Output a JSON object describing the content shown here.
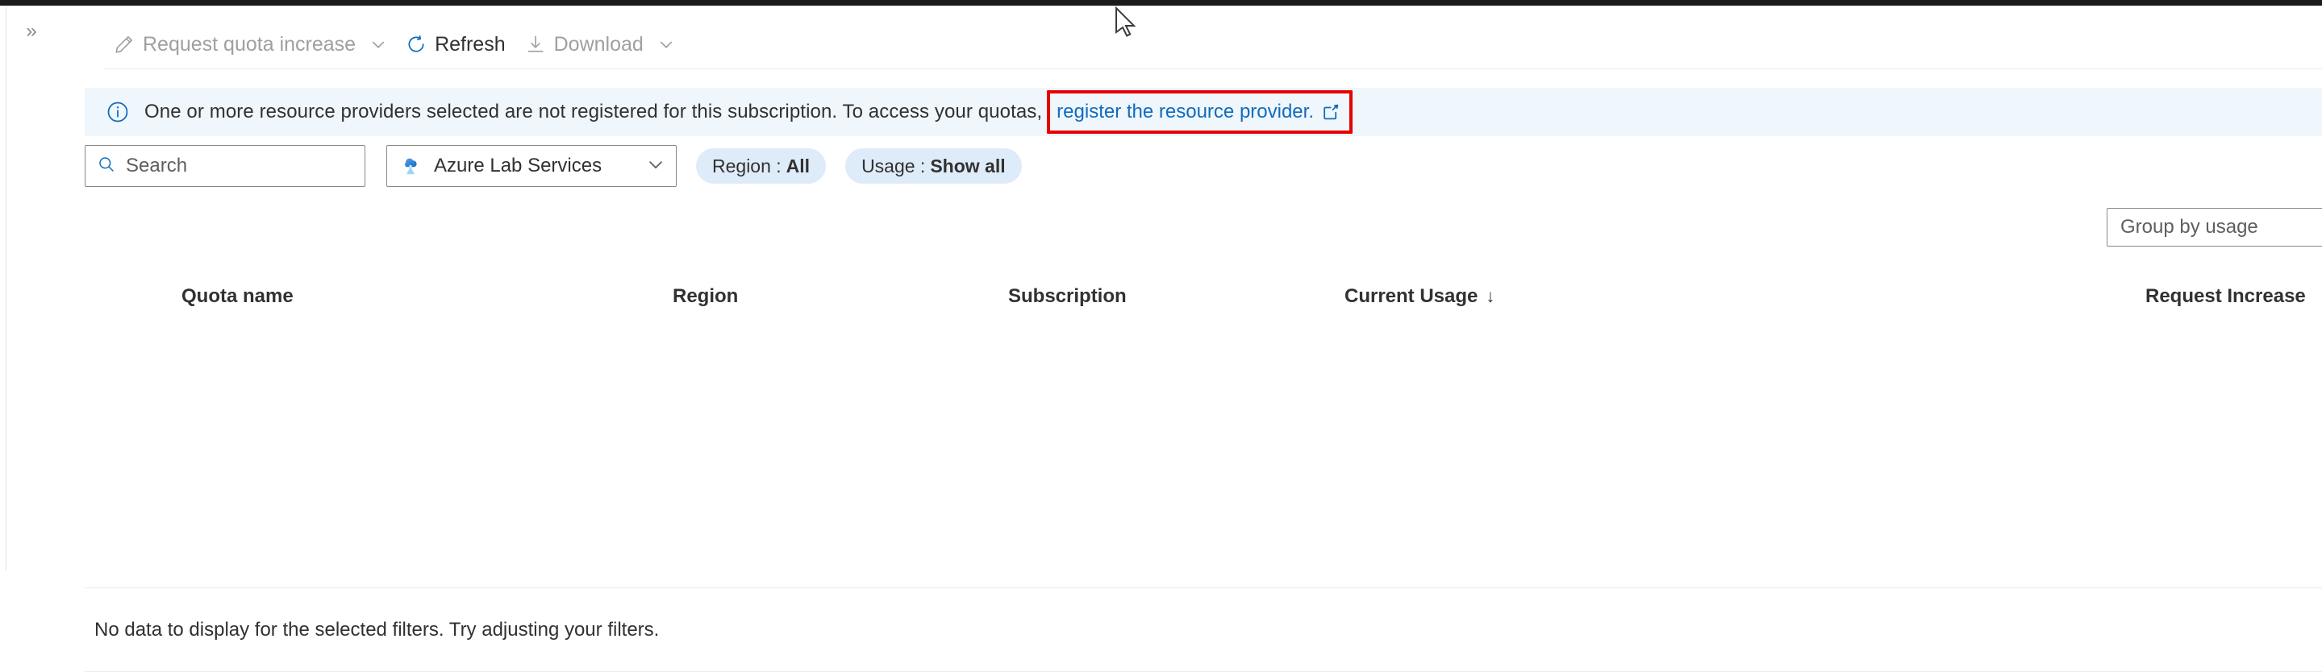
{
  "window": {
    "expand_chevron": "»"
  },
  "toolbar": {
    "items": [
      {
        "label": "Request quota increase",
        "icon": "pencil-icon",
        "enabled": false,
        "has_caret": true
      },
      {
        "label": "Refresh",
        "icon": "refresh-icon",
        "enabled": true,
        "has_caret": false
      },
      {
        "label": "Download",
        "icon": "download-icon",
        "enabled": false,
        "has_caret": true
      }
    ]
  },
  "banner": {
    "icon": "info-icon",
    "message": "One or more resource providers selected are not registered for this subscription. To access your quotas,",
    "link_text": "register the resource provider.",
    "link_icon": "external-link-icon",
    "highlight_color": "#e60000",
    "background": "#eff6fc"
  },
  "filters": {
    "search": {
      "placeholder": "Search",
      "value": "",
      "icon": "search-icon"
    },
    "provider": {
      "value": "Azure Lab Services",
      "icon": "azure-lab-services-icon",
      "caret": "chevron-down-icon"
    },
    "pills": [
      {
        "key": "Region :",
        "value": "All"
      },
      {
        "key": "Usage :",
        "value": "Show all"
      }
    ]
  },
  "group_by": {
    "label": "Group by usage"
  },
  "table": {
    "columns": [
      {
        "label": "Quota name",
        "sorted": false,
        "sort_arrow": ""
      },
      {
        "label": "Region",
        "sorted": false,
        "sort_arrow": ""
      },
      {
        "label": "Subscription",
        "sorted": false,
        "sort_arrow": ""
      },
      {
        "label": "Current Usage",
        "sorted": true,
        "sort_arrow": "↓"
      },
      {
        "label": "Request Increase",
        "sorted": false,
        "sort_arrow": ""
      }
    ],
    "empty_message": "No data to display for the selected filters. Try adjusting your filters."
  },
  "colors": {
    "accent": "#0f6cbd",
    "banner_bg": "#eff6fc",
    "pill_bg": "#deecf9",
    "text": "#323130",
    "disabled_text": "#a19f9d"
  }
}
